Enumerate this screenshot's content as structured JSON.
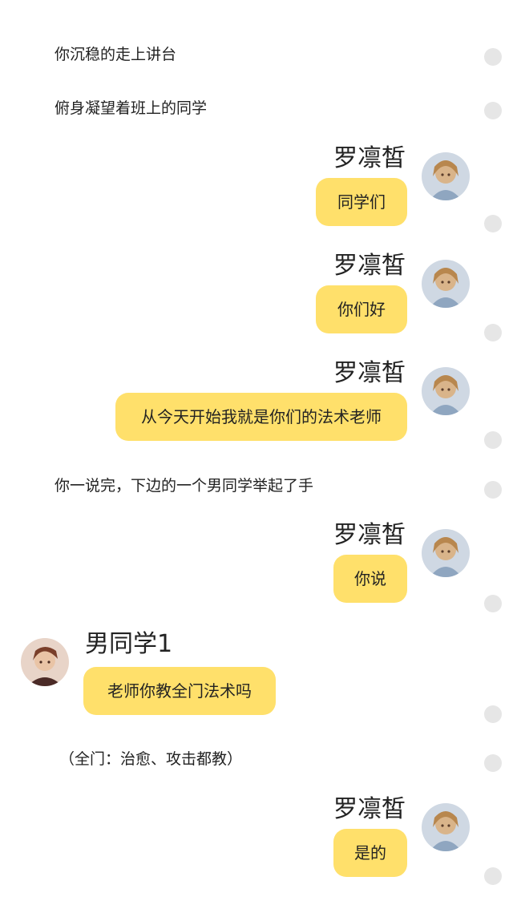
{
  "narrations": [
    {
      "text": "你沉稳的走上讲台"
    },
    {
      "text": "俯身凝望着班上的同学"
    },
    {
      "text": "你一说完，下边的一个男同学举起了手"
    },
    {
      "text": "（全门：治愈、攻击都教）"
    }
  ],
  "messages": [
    {
      "speaker": "罗凛皙",
      "text": "同学们",
      "avatar": "anime-girl-avatar"
    },
    {
      "speaker": "罗凛皙",
      "text": "你们好",
      "avatar": "anime-girl-avatar"
    },
    {
      "speaker": "罗凛皙",
      "text": "从今天开始我就是你们的法术老师",
      "avatar": "anime-girl-avatar"
    },
    {
      "speaker": "罗凛皙",
      "text": "你说",
      "avatar": "anime-girl-avatar"
    },
    {
      "speaker": "男同学1",
      "text": "老师你教全门法术吗",
      "avatar": "anime-boy-avatar"
    },
    {
      "speaker": "罗凛皙",
      "text": "是的",
      "avatar": "anime-girl-avatar"
    }
  ],
  "colors": {
    "bubble": "#ffe06b",
    "dot": "#e6e6e6",
    "background": "#ffffff"
  }
}
